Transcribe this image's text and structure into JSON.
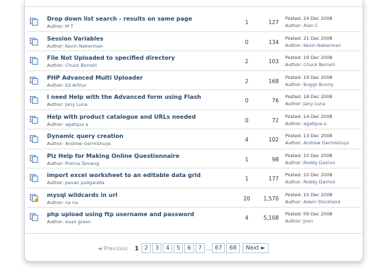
{
  "topics": [
    {
      "title": "Drop down list search - results on same page",
      "author_label": "Author:",
      "author": "M T",
      "replies": "1",
      "views": "127",
      "posted": "Posted: 24 Dec 2008",
      "by_label": "Author:",
      "last_author": "Alan C",
      "icon": "document-icon"
    },
    {
      "title": "Session Variables",
      "author_label": "Author:",
      "author": "Kevin Neberman",
      "replies": "0",
      "views": "134",
      "posted": "Posted: 21 Dec 2008",
      "by_label": "Author:",
      "last_author": "Kevin Neberman",
      "icon": "document-icon"
    },
    {
      "title": "File Not Uploaded to specified directory",
      "author_label": "Author:",
      "author": "Chuck Borrelli",
      "replies": "2",
      "views": "103",
      "posted": "Posted: 19 Dec 2008",
      "by_label": "Author:",
      "last_author": "Chuck Borrelli",
      "icon": "document-icon"
    },
    {
      "title": "PHP Advanced Multi Uploader",
      "author_label": "Author:",
      "author": "Ed Arthur",
      "replies": "2",
      "views": "168",
      "posted": "Posted: 19 Dec 2008",
      "by_label": "Author:",
      "last_author": "Buggz Bunny",
      "icon": "document-icon"
    },
    {
      "title": "I need Help with the Advanced form using Flash",
      "author_label": "Author:",
      "author": "Jany Luna",
      "replies": "0",
      "views": "76",
      "posted": "Posted: 18 Dec 2008",
      "by_label": "Author:",
      "last_author": "Jany Luna",
      "icon": "document-icon"
    },
    {
      "title": "Help with product catalogue and URLs needed",
      "author_label": "Author:",
      "author": "agatqua a",
      "replies": "0",
      "views": "72",
      "posted": "Posted: 14 Dec 2008",
      "by_label": "Author:",
      "last_author": "agatqua a",
      "icon": "document-icon"
    },
    {
      "title": "Dynamic query creation",
      "author_label": "Author:",
      "author": "Andrew Germishuys",
      "replies": "4",
      "views": "102",
      "posted": "Posted: 13 Dec 2008",
      "by_label": "Author:",
      "last_author": "Andrew Germishuys",
      "icon": "document-icon"
    },
    {
      "title": "Plz Help for Making Online Questionnaire",
      "author_label": "Author:",
      "author": "Prerna Tamang",
      "replies": "1",
      "views": "98",
      "posted": "Posted: 10 Dec 2008",
      "by_label": "Author:",
      "last_author": "Roddy Dairion",
      "icon": "document-icon"
    },
    {
      "title": "import excel worksheet to an editable data grid",
      "author_label": "Author:",
      "author": "pavan puligandla",
      "replies": "1",
      "views": "177",
      "posted": "Posted: 10 Dec 2008",
      "by_label": "Author:",
      "last_author": "Roddy Dairion",
      "icon": "document-icon"
    },
    {
      "title": "mysql wildcards in url",
      "author_label": "Author:",
      "author": "na na",
      "replies": "20",
      "views": "1,570",
      "posted": "Posted: 10 Dec 2008",
      "by_label": "Author:",
      "last_author": "Adam Stockland",
      "icon": "hot-document-icon"
    },
    {
      "title": "php upload using ftp username and password",
      "author_label": "Author:",
      "author": "euan green",
      "replies": "4",
      "views": "5,108",
      "posted": "Posted: 09 Dec 2008",
      "by_label": "Author:",
      "last_author": "Jxon",
      "icon": "document-icon"
    }
  ],
  "pagination": {
    "previous": "◄ Previous",
    "current": "1",
    "pages": [
      "2",
      "3",
      "4",
      "5",
      "6",
      "7"
    ],
    "ellipsis": "...",
    "tail_pages": [
      "67",
      "68"
    ],
    "next": "Next ►"
  },
  "colors": {
    "title": "#2c4a70",
    "link": "#4a6a8c",
    "icon_blue": "#5b87c5",
    "icon_hot": "#e8b400"
  }
}
